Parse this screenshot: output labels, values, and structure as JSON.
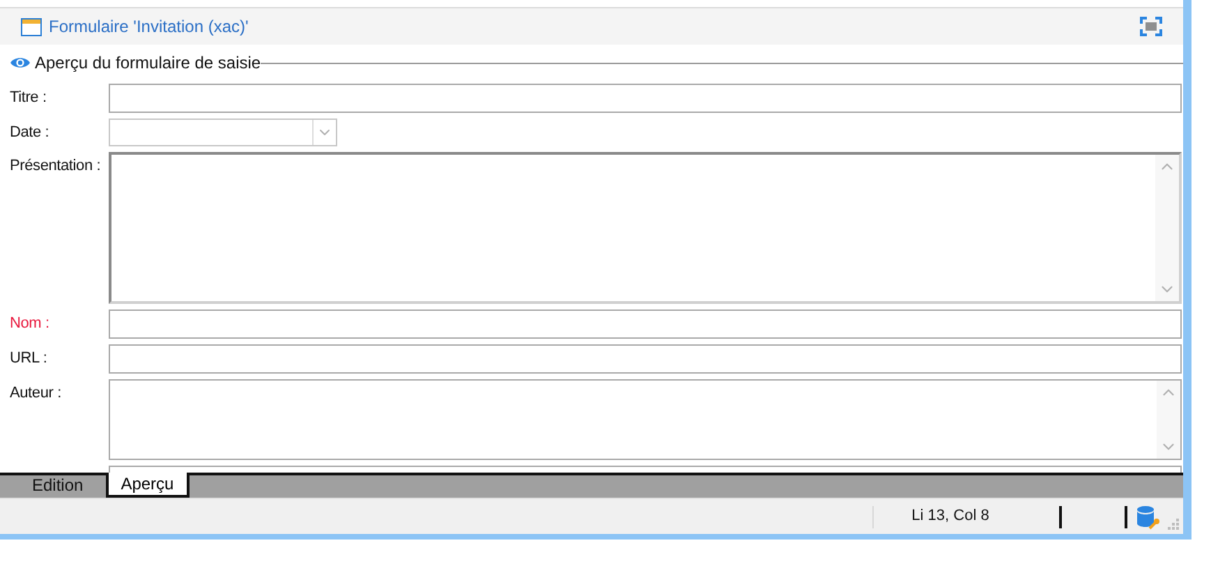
{
  "window": {
    "title": "Formulaire 'Invitation (xac)'"
  },
  "section_title": "Aperçu du formulaire de saisie",
  "fields": [
    {
      "kind": "text",
      "label": "Titre :",
      "required": false
    },
    {
      "kind": "dropdown",
      "label": "Date :",
      "required": false
    },
    {
      "kind": "textarea",
      "label": "Présentation :",
      "required": false
    },
    {
      "kind": "text",
      "label": "Nom :",
      "required": true
    },
    {
      "kind": "text",
      "label": "URL :",
      "required": false
    },
    {
      "kind": "textarea",
      "label": "Auteur :",
      "required": false
    },
    {
      "kind": "text"
    }
  ],
  "tabs": [
    {
      "label": "Edition",
      "selected": false
    },
    {
      "label": "Aperçu",
      "selected": true
    }
  ],
  "status_bar": {
    "position": "Li 13, Col 8"
  }
}
